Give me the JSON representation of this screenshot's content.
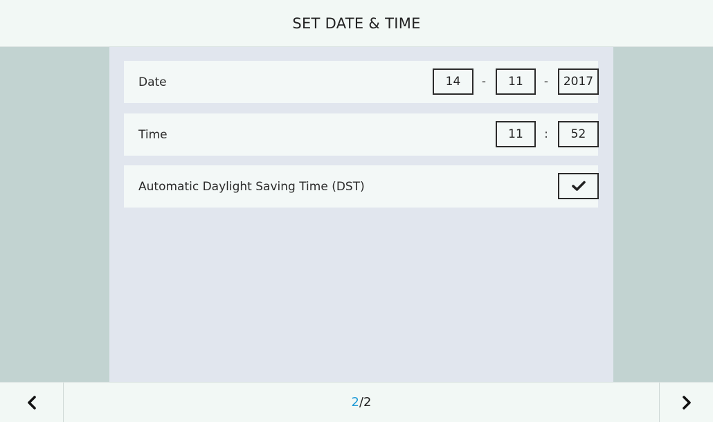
{
  "header": {
    "title": "SET DATE & TIME"
  },
  "settings": {
    "date": {
      "label": "Date",
      "day": "14",
      "month": "11",
      "year": "2017",
      "separator": "-"
    },
    "time": {
      "label": "Time",
      "hour": "11",
      "minute": "52",
      "separator": ":"
    },
    "dst": {
      "label": "Automatic Daylight Saving Time (DST)",
      "checked": true,
      "icon": "checkmark-icon"
    }
  },
  "footer": {
    "prev_icon": "chevron-left-icon",
    "next_icon": "chevron-right-icon",
    "page_current": "2",
    "page_separator": "/",
    "page_total": "2"
  },
  "colors": {
    "accent": "#1f9bd7",
    "side_panel": "#c2d3d1",
    "content_bg": "#e1e6ee",
    "row_bg": "#f3f8f7"
  }
}
